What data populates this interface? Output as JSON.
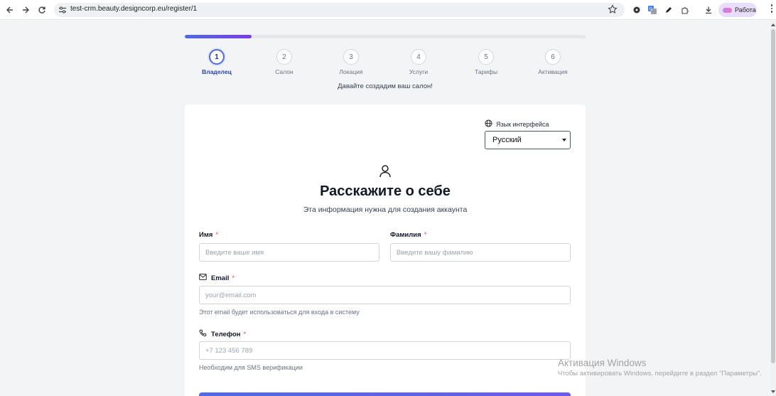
{
  "browser": {
    "url": "test-crm.beauty.designcorp.eu/register/1",
    "profile_label": "Работа"
  },
  "progress": {
    "fraction": 0.167
  },
  "steps": [
    {
      "number": "1",
      "label": "Владелец",
      "active": true
    },
    {
      "number": "2",
      "label": "Салон"
    },
    {
      "number": "3",
      "label": "Локация"
    },
    {
      "number": "4",
      "label": "Услуги"
    },
    {
      "number": "5",
      "label": "Тарифы"
    },
    {
      "number": "6",
      "label": "Активация"
    }
  ],
  "intro": "Давайте создадим ваш салон!",
  "language": {
    "label": "Язык интерфейса",
    "selected": "Русский"
  },
  "form": {
    "heading": "Расскажите о себе",
    "subheading": "Эта информация нужна для создания аккаунта",
    "first_name": {
      "label": "Имя",
      "required": "*",
      "placeholder": "Введите ваше имя"
    },
    "last_name": {
      "label": "Фамилия",
      "required": "*",
      "placeholder": "Введите вашу фамилию"
    },
    "email": {
      "label": "Email",
      "required": "*",
      "placeholder": "your@email.com",
      "hint": "Этот email будет использоваться для входа в систему"
    },
    "phone": {
      "label": "Телефон",
      "required": "*",
      "placeholder": "+7 123 456 789",
      "hint": "Необходим для SMS верификации"
    }
  },
  "watermark": {
    "title": "Активация Windows",
    "text": "Чтобы активировать Windows, перейдите в раздел \"Параметры\"."
  },
  "colors": {
    "accent": "#4f6ae3",
    "accent2": "#7c3aed",
    "required": "#ef4444"
  }
}
